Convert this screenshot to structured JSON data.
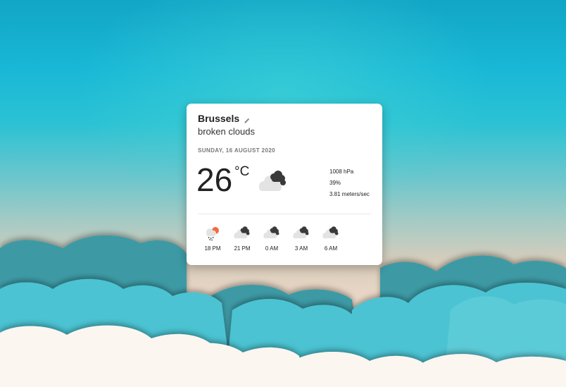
{
  "location": {
    "city": "Brussels",
    "description": "broken clouds"
  },
  "date": "SUNDAY, 16 AUGUST 2020",
  "current": {
    "temperature": "26",
    "unit": "°C",
    "icon": "broken-clouds-icon",
    "pressure": "1008 hPa",
    "humidity": "39%",
    "wind": "3.81 meters/sec"
  },
  "forecast": [
    {
      "time": "18 PM",
      "icon": "rain-sun-icon"
    },
    {
      "time": "21 PM",
      "icon": "broken-clouds-icon"
    },
    {
      "time": "0 AM",
      "icon": "broken-clouds-icon"
    },
    {
      "time": "3 AM",
      "icon": "broken-clouds-icon"
    },
    {
      "time": "6 AM",
      "icon": "broken-clouds-icon"
    }
  ],
  "colors": {
    "accent": "#f26c3a",
    "dark_cloud": "#3a3a3a",
    "light_cloud": "#e3e3e3"
  }
}
